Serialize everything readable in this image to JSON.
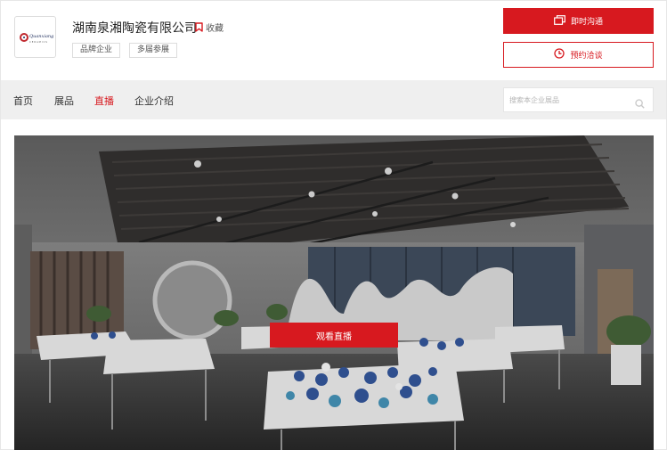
{
  "company": {
    "name": "湖南泉湘陶瓷有限公司",
    "favorite_label": "收藏",
    "tags": [
      "品牌企业",
      "多届参展"
    ],
    "logo_text": "Quanxiang",
    "logo_sub": "CERAMICS"
  },
  "actions": {
    "chat_label": "即时沟通",
    "appointment_label": "预约洽谈"
  },
  "nav": {
    "items": [
      {
        "label": "首页",
        "active": false
      },
      {
        "label": "展品",
        "active": false
      },
      {
        "label": "直播",
        "active": true
      },
      {
        "label": "企业介绍",
        "active": false
      }
    ],
    "search_placeholder": "搜索本企业展品"
  },
  "hero": {
    "watch_label": "观看直播"
  },
  "colors": {
    "accent": "#d7191f",
    "nav_bg": "#efefef"
  },
  "icons": {
    "favorite": "bookmark-icon",
    "chat": "chat-window-icon",
    "appointment": "clock-icon",
    "search": "search-icon"
  }
}
